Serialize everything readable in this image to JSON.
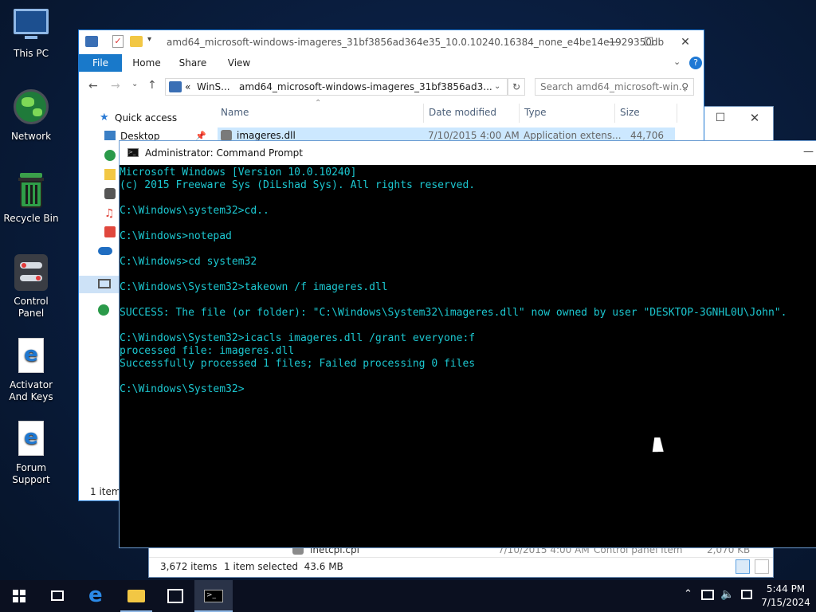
{
  "desktop": {
    "icons": [
      {
        "label": "This PC"
      },
      {
        "label": "Network"
      },
      {
        "label": "Recycle Bin"
      },
      {
        "label": "Control Panel"
      },
      {
        "label": "Activator And Keys"
      },
      {
        "label": "Forum Support"
      }
    ]
  },
  "explorer_back": {
    "status_items": "3,672 items",
    "status_selected": "1 item selected  43.6 MB",
    "row": {
      "name": "inetcpl.cpl",
      "date": "7/10/2015 4:00 AM",
      "type": "Control panel item",
      "size": "2,070 KB"
    }
  },
  "explorer_front": {
    "title": "amd64_microsoft-windows-imageres_31bf3856ad364e35_10.0.10240.16384_none_e4be14e1929350db",
    "tabs": [
      "File",
      "Home",
      "Share",
      "View"
    ],
    "address_prefix": "«  WinS...",
    "address_path": "amd64_microsoft-windows-imageres_31bf3856ad3...",
    "search_placeholder": "Search amd64_microsoft-win...",
    "nav": {
      "quick_access": "Quick access",
      "desktop": "Desktop"
    },
    "columns": [
      "Name",
      "Date modified",
      "Type",
      "Size"
    ],
    "file": {
      "name": "imageres.dll",
      "date": "7/10/2015 4:00 AM",
      "type": "Application extens...",
      "size": "44,706 KB"
    },
    "status": "1 item"
  },
  "cmd": {
    "title": "Administrator: Command Prompt",
    "lines": [
      "Microsoft Windows [Version 10.0.10240]",
      "(c) 2015 Freeware Sys (DiLshad Sys). All rights reserved.",
      "",
      "C:\\Windows\\system32>cd..",
      "",
      "C:\\Windows>notepad",
      "",
      "C:\\Windows>cd system32",
      "",
      "C:\\Windows\\System32>takeown /f imageres.dll",
      "",
      "SUCCESS: The file (or folder): \"C:\\Windows\\System32\\imageres.dll\" now owned by user \"DESKTOP-3GNHL0U\\John\".",
      "",
      "C:\\Windows\\System32>icacls imageres.dll /grant everyone:f",
      "processed file: imageres.dll",
      "Successfully processed 1 files; Failed processing 0 files",
      "",
      "C:\\Windows\\System32>"
    ]
  },
  "taskbar": {
    "time": "5:44 PM",
    "date": "7/15/2024"
  },
  "colors": {
    "console_text": "#1cc7d0",
    "accent": "#1979ca"
  }
}
